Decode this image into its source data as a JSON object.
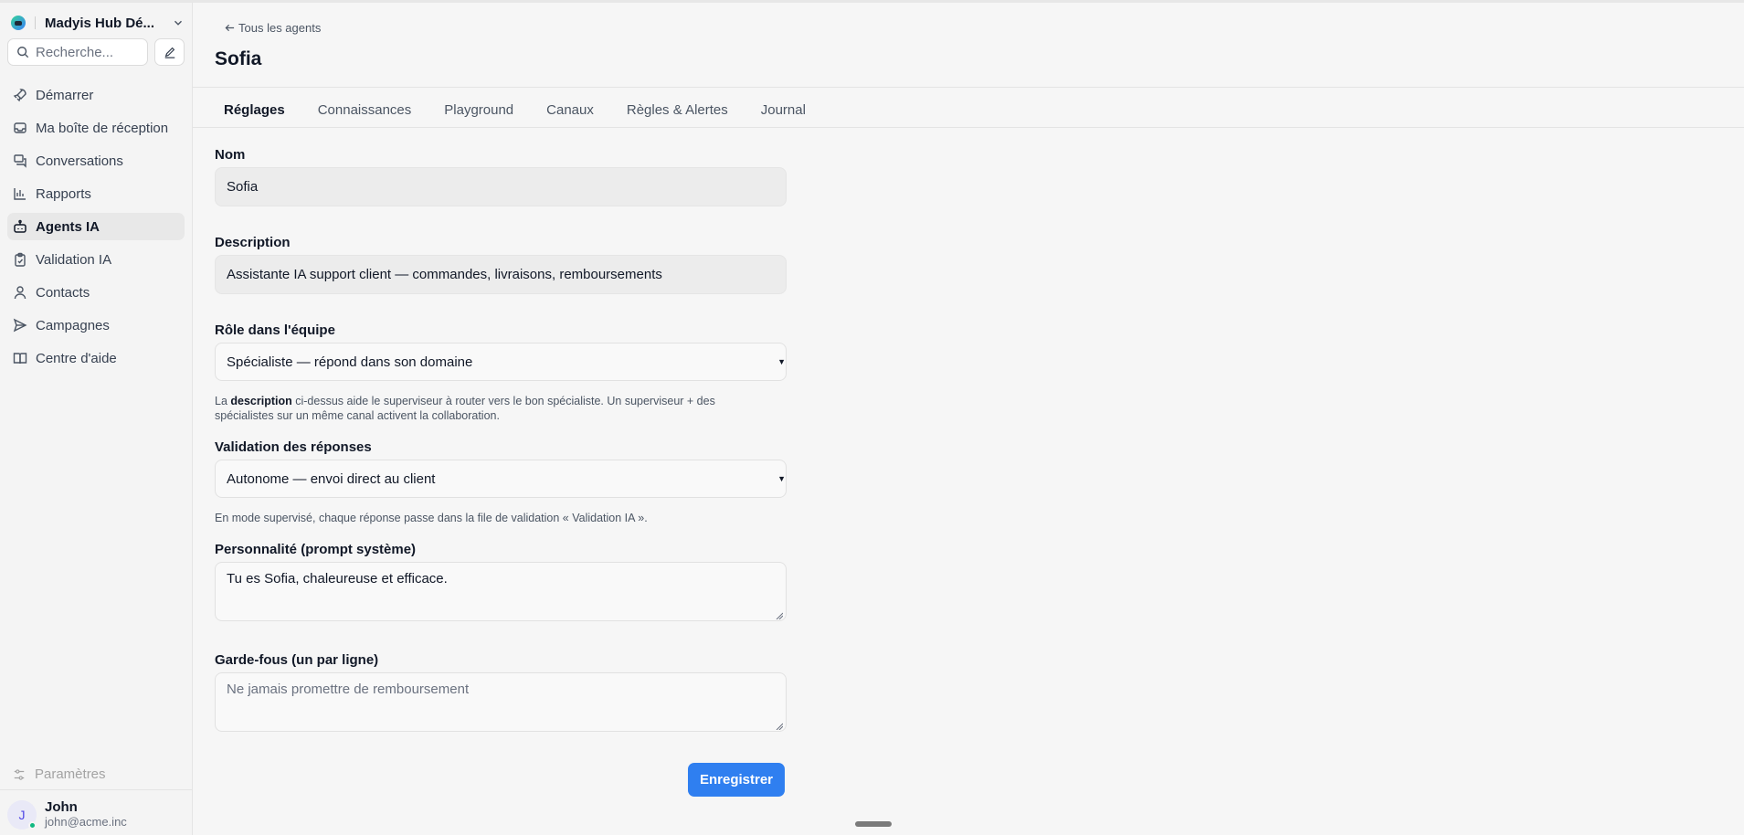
{
  "sidebar": {
    "workspace_name": "Madyis Hub Dé...",
    "search_placeholder": "Recherche...",
    "items": [
      {
        "label": "Démarrer",
        "icon": "rocket-icon"
      },
      {
        "label": "Ma boîte de réception",
        "icon": "inbox-icon"
      },
      {
        "label": "Conversations",
        "icon": "chat-icon"
      },
      {
        "label": "Rapports",
        "icon": "bar-chart-icon"
      },
      {
        "label": "Agents IA",
        "icon": "bot-icon",
        "active": true
      },
      {
        "label": "Validation IA",
        "icon": "clipboard-check-icon"
      },
      {
        "label": "Contacts",
        "icon": "user-icon"
      },
      {
        "label": "Campagnes",
        "icon": "send-icon"
      },
      {
        "label": "Centre d'aide",
        "icon": "book-icon"
      }
    ],
    "settings_label": "Paramètres",
    "user": {
      "initial": "J",
      "name": "John",
      "email": "john@acme.inc",
      "status_color": "#10b981"
    }
  },
  "header": {
    "back_label": "Tous les agents",
    "title": "Sofia"
  },
  "tabs": [
    {
      "label": "Réglages",
      "active": true
    },
    {
      "label": "Connaissances"
    },
    {
      "label": "Playground"
    },
    {
      "label": "Canaux"
    },
    {
      "label": "Règles & Alertes"
    },
    {
      "label": "Journal"
    }
  ],
  "form": {
    "name_label": "Nom",
    "name_value": "Sofia",
    "description_label": "Description",
    "description_value": "Assistante IA support client — commandes, livraisons, remboursements",
    "role_label": "Rôle dans l'équipe",
    "role_value": "Spécialiste — répond dans son domaine",
    "role_help_prefix": "La ",
    "role_help_bold": "description",
    "role_help_suffix": " ci-dessus aide le superviseur à router vers le bon spécialiste. Un superviseur + des spécialistes sur un même canal activent la collaboration.",
    "validation_label": "Validation des réponses",
    "validation_value": "Autonome — envoi direct au client",
    "validation_help": "En mode supervisé, chaque réponse passe dans la file de validation « Validation IA ».",
    "prompt_label": "Personnalité (prompt système)",
    "prompt_value": "Tu es Sofia, chaleureuse et efficace.",
    "guardrails_label": "Garde-fous (un par ligne)",
    "guardrails_placeholder": "Ne jamais promettre de remboursement",
    "save_label": "Enregistrer"
  },
  "colors": {
    "accent": "#2f7ff0",
    "active_nav_bg": "#e8e8e8"
  }
}
